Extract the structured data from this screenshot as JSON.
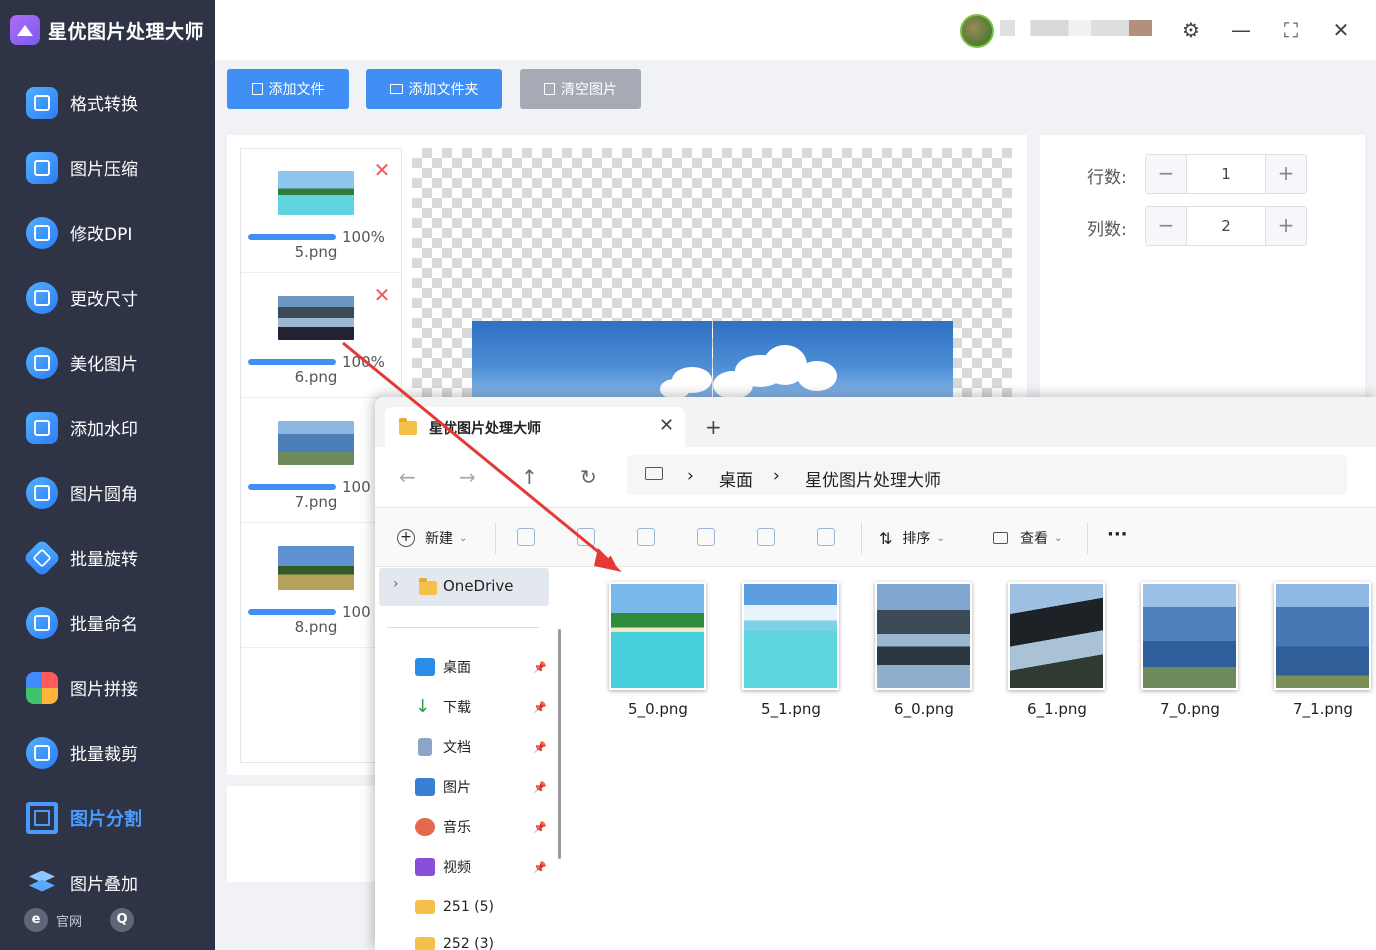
{
  "app": {
    "title": "星优图片处理大师",
    "nav": [
      {
        "label": "格式转换",
        "icon": "format-convert-icon"
      },
      {
        "label": "图片压缩",
        "icon": "compress-icon"
      },
      {
        "label": "修改DPI",
        "icon": "dpi-icon"
      },
      {
        "label": "更改尺寸",
        "icon": "resize-icon"
      },
      {
        "label": "美化图片",
        "icon": "beautify-icon"
      },
      {
        "label": "添加水印",
        "icon": "watermark-icon"
      },
      {
        "label": "图片圆角",
        "icon": "rounded-corner-icon"
      },
      {
        "label": "批量旋转",
        "icon": "rotate-icon"
      },
      {
        "label": "批量命名",
        "icon": "rename-icon"
      },
      {
        "label": "图片拼接",
        "icon": "puzzle-icon"
      },
      {
        "label": "批量裁剪",
        "icon": "crop-icon"
      },
      {
        "label": "图片分割",
        "icon": "split-icon"
      },
      {
        "label": "图片叠加",
        "icon": "layers-icon"
      }
    ],
    "active_nav": "图片分割",
    "footer": {
      "website": "官网",
      "website_icon_glyph": "e",
      "service_icon_glyph": "Q"
    }
  },
  "toolbar": {
    "add_file": "添加文件",
    "add_folder": "添加文件夹",
    "clear": "清空图片"
  },
  "window_controls": {
    "settings": "⚙",
    "minimize": "—",
    "maximize": "⛶",
    "close": "✕"
  },
  "file_list": [
    {
      "name": "5.png",
      "progress_pct": 100,
      "progress_label": "100%"
    },
    {
      "name": "6.png",
      "progress_pct": 100,
      "progress_label": "100%"
    },
    {
      "name": "7.png",
      "progress_pct": 100,
      "progress_label": "100"
    },
    {
      "name": "8.png",
      "progress_pct": 100,
      "progress_label": "100"
    }
  ],
  "settings": {
    "rows_label": "行数:",
    "rows_value": "1",
    "cols_label": "列数:",
    "cols_value": "2",
    "minus": "−",
    "plus": "+"
  },
  "explorer": {
    "tab_title": "星优图片处理大师",
    "tab_close": "✕",
    "new_tab": "+",
    "nav": {
      "back": "←",
      "forward": "→",
      "up": "↑",
      "refresh": "↻"
    },
    "breadcrumb": [
      "桌面",
      "星优图片处理大师"
    ],
    "breadcrumb_sep": "›",
    "commands": {
      "new": "新建",
      "sort": "排序",
      "view": "查看",
      "more": "···",
      "dropdown": "⌄"
    },
    "sidebar": {
      "onedrive": "OneDrive",
      "expand": "›",
      "pin": "📌",
      "items": [
        {
          "label": "桌面",
          "color": "#2b8ee6"
        },
        {
          "label": "下载",
          "color": "#2e9d4f"
        },
        {
          "label": "文档",
          "color": "#8da3c8"
        },
        {
          "label": "图片",
          "color": "#3a7fd6"
        },
        {
          "label": "音乐",
          "color": "#e46a4b"
        },
        {
          "label": "视频",
          "color": "#8a4fd8"
        },
        {
          "label": "251 (5)",
          "color": "#f3c14a"
        },
        {
          "label": "252 (3)",
          "color": "#f3c14a"
        }
      ]
    },
    "files": [
      "5_0.png",
      "5_1.png",
      "6_0.png",
      "6_1.png",
      "7_0.png",
      "7_1.png"
    ]
  },
  "colors": {
    "accent": "#3f8ff5",
    "sidebar_bg": "#2e3446",
    "active_nav": "#4b9bff",
    "arrow": "#e53935"
  }
}
